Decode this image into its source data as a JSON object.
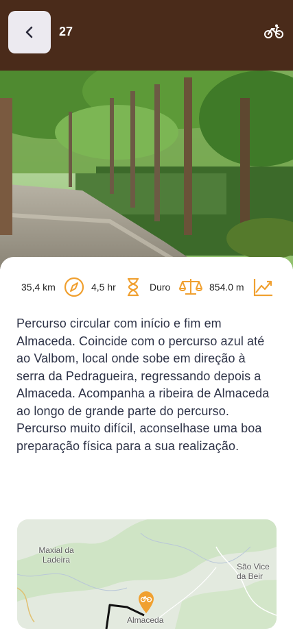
{
  "header": {
    "route_number": "27",
    "back_icon": "chevron-left-icon",
    "activity_icon": "bicycle-icon"
  },
  "stats": [
    {
      "value": "35,4 km",
      "icon": "compass-icon"
    },
    {
      "value": "4,5 hr",
      "icon": "hourglass-icon"
    },
    {
      "value": "Duro",
      "icon": "scale-icon"
    },
    {
      "value": "854.0 m",
      "icon": "trending-up-icon"
    }
  ],
  "description": "Percurso circular com início e fim em Almaceda. Coincide com o percurso azul até ao Valbom, local onde sobe em direção à serra da Pedragueira, regressando depois a Almaceda. Acompanha a ribeira de Almaceda ao longo de grande parte do percurso. Percurso muito difícil, aconselhase uma boa preparação física para a sua realização.",
  "map": {
    "labels": {
      "maxial": "Maxial da Ladeira",
      "sao_vicente": "São Vice da Beir",
      "almaceda": "Almaceda"
    },
    "marker_icon": "bicycle-pin-icon"
  },
  "colors": {
    "header_bg": "#4a2b1a",
    "accent": "#f0a030",
    "text": "#2f3448"
  }
}
